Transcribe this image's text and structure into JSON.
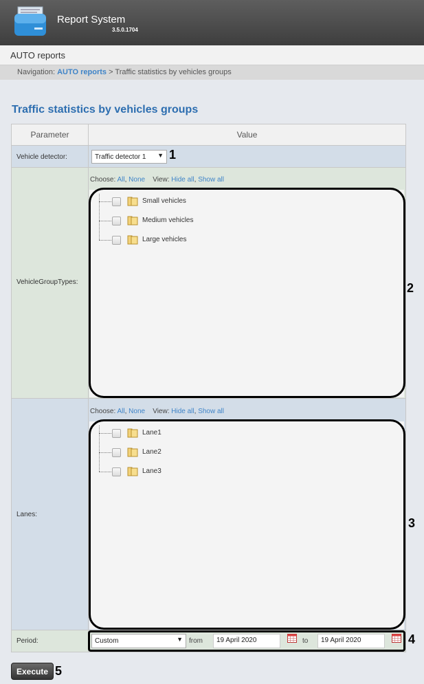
{
  "app": {
    "title": "Report System",
    "version": "3.5.0.1704"
  },
  "section": "AUTO reports",
  "navigation": {
    "prefix": "Navigation:",
    "link": "AUTO reports",
    "separator": ">",
    "current": "Traffic statistics by vehicles groups"
  },
  "page_title": "Traffic statistics by vehicles groups",
  "table": {
    "col_parameter": "Parameter",
    "col_value": "Value"
  },
  "vehicle_detector": {
    "label": "Vehicle detector:",
    "value": "Traffic detector 1"
  },
  "vehicle_group_types": {
    "label": "VehicleGroupTypes:",
    "choose": "Choose:",
    "all": "All",
    "none": "None",
    "view": "View:",
    "hide_all": "Hide all",
    "show_all": "Show all",
    "items": [
      "Small vehicles",
      "Medium vehicles",
      "Large vehicles"
    ]
  },
  "lanes": {
    "label": "Lanes:",
    "choose": "Choose:",
    "all": "All",
    "none": "None",
    "view": "View:",
    "hide_all": "Hide all",
    "show_all": "Show all",
    "items": [
      "Lane1",
      "Lane2",
      "Lane3"
    ]
  },
  "period": {
    "label": "Period:",
    "value": "Custom",
    "from_label": "from",
    "from_date": "19 April 2020",
    "to_label": "to",
    "to_date": "19 April 2020"
  },
  "execute_label": "Execute",
  "callouts": [
    "1",
    "2",
    "3",
    "4",
    "5"
  ],
  "colors": {
    "accent": "#3f84c8",
    "title": "#2d6eb0"
  }
}
